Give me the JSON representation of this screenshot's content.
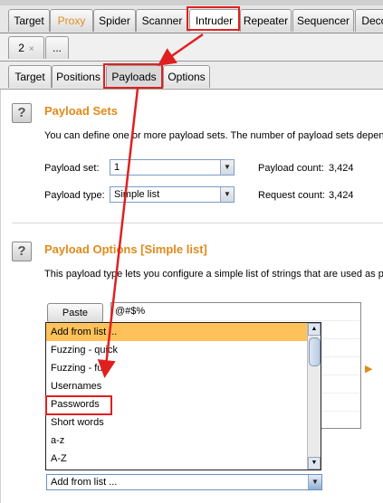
{
  "main_tabs": [
    "Target",
    "Proxy",
    "Spider",
    "Scanner",
    "Intruder",
    "Repeater",
    "Sequencer",
    "Decc"
  ],
  "instance_tabs": {
    "tab_label": "2",
    "close": "×",
    "more": "..."
  },
  "intruder_tabs": [
    "Target",
    "Positions",
    "Payloads",
    "Options"
  ],
  "payload_sets": {
    "help": "?",
    "title": "Payload Sets",
    "description": "You can define one or more payload sets. The number of payload sets depen",
    "set_label": "Payload set:",
    "set_value": "1",
    "count_label": "Payload count:",
    "count_value": "3,424",
    "type_label": "Payload type:",
    "type_value": "Simple list",
    "request_label": "Request count:",
    "request_value": "3,424"
  },
  "payload_options": {
    "help": "?",
    "title": "Payload Options [Simple list]",
    "description": "This payload type lets you configure a simple list of strings that are used as pa",
    "paste_button": "Paste",
    "list_first_item": "@#$%",
    "add_from_list": "Add from list ...",
    "side_marker": "▶"
  },
  "dropdown_options": [
    "Add from list ...",
    "Fuzzing - quick",
    "Fuzzing - full",
    "Usernames",
    "Passwords",
    "Short words",
    "a-z",
    "A-Z"
  ],
  "colors": {
    "accent": "#e08a1a",
    "highlight": "#e02020",
    "selected_option": "#ffc25a"
  }
}
